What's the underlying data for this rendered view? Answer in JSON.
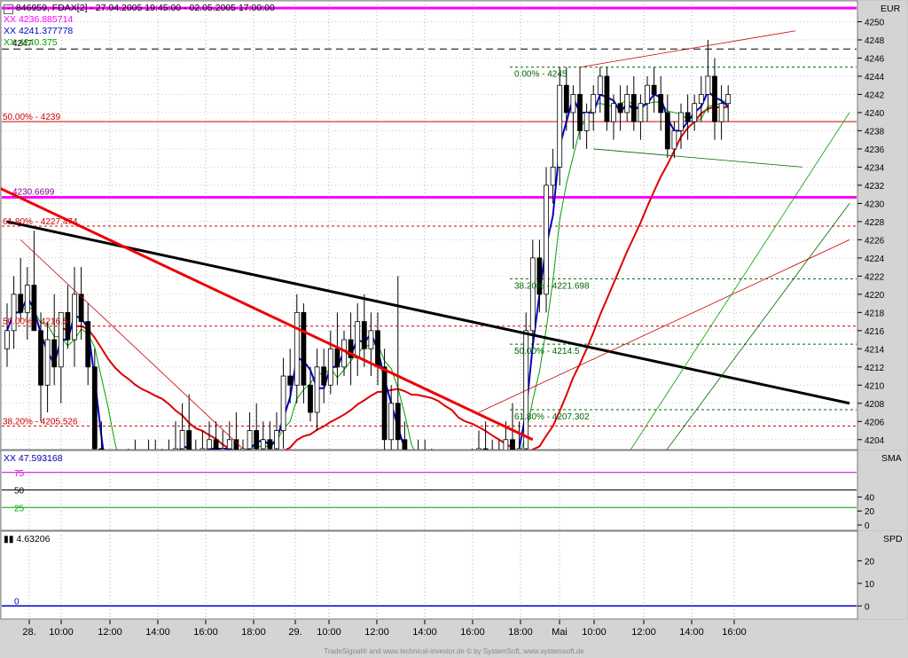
{
  "window": {
    "title": "846959, FDAX[2] - 27.04.2005 19:45:00 - 02.05.2005 17:00:00",
    "footer": "TradeSignal® and www.technical-investor.de © by SystemSoft, www.systemsoft.de"
  },
  "colors": {
    "candle": "#000000",
    "bb_blue": "#0000cc",
    "green": "#00a000",
    "ma_red": "#dd0000",
    "magenta": "#ff00ff",
    "fib_red": "#cc0000",
    "fib_green": "#006600",
    "trend_black": "#000000",
    "trend_red": "#ee0000",
    "bars": "#808080",
    "indicator_blue": "#0000aa"
  },
  "legend": [
    {
      "prefix": "XX",
      "value": "4236.885714",
      "color": "#ff00ff"
    },
    {
      "prefix": "XX",
      "value": "4241.377778",
      "color": "#0000cc"
    },
    {
      "prefix": "XX",
      "value": "4240.375",
      "color": "#00a000"
    }
  ],
  "panels": {
    "price": {
      "unit": "EUR",
      "ylim": [
        4203,
        4252
      ]
    },
    "sma": {
      "label": "SMA",
      "legend": "XX 47.593168",
      "ylim": [
        -5,
        100
      ]
    },
    "spd": {
      "label": "SPD",
      "legend": "4.63206",
      "ylim": [
        -5,
        28
      ]
    }
  },
  "time_axis": [
    "28.",
    "10:00",
    "12:00",
    "14:00",
    "16:00",
    "18:00",
    "29.",
    "10:00",
    "12:00",
    "14:00",
    "16:00",
    "18:00",
    "Mai",
    "10:00",
    "12:00",
    "14:00",
    "16:00"
  ],
  "chart_data": [
    {
      "type": "candlestick",
      "title": "846959, FDAX[2] - 27.04.2005 19:45:00 - 02.05.2005 17:00:00",
      "ylabel": "EUR",
      "y_ticks": [
        4204,
        4206,
        4208,
        4210,
        4212,
        4214,
        4216,
        4218,
        4220,
        4222,
        4224,
        4226,
        4228,
        4230,
        4232,
        4234,
        4236,
        4238,
        4240,
        4242,
        4244,
        4246,
        4248,
        4250
      ],
      "ylim": [
        4203,
        4252
      ],
      "horizontal_lines": [
        {
          "label": "4236.885714",
          "price": 4251.5,
          "style": "solid-magenta",
          "label_price": 4252.4
        },
        {
          "label": "4247",
          "price": 4247,
          "style": "dashed-black"
        },
        {
          "label": "4230.6699",
          "price": 4230.67,
          "style": "solid-magenta"
        }
      ],
      "fib_left": [
        {
          "label": "50.00% - 4239",
          "price": 4239
        },
        {
          "label": "61.80% - 4227.474",
          "price": 4227.5
        },
        {
          "label": "50.00% - 4216.5",
          "price": 4216.5,
          "level_label": "50.00% - 4216.5"
        },
        {
          "label": "38.20% - 4205.526",
          "price": 4205.5
        }
      ],
      "fib_right": [
        {
          "label": "0.00% - 4245",
          "price": 4245
        },
        {
          "label": "38.20% - 4221.698",
          "price": 4221.7
        },
        {
          "label": "50.00% - 4214.5",
          "price": 4214.5
        },
        {
          "label": "61.80% - 4207.302",
          "price": 4207.3
        }
      ],
      "candles": [
        [
          4214,
          4219,
          4212,
          4216
        ],
        [
          4216,
          4222,
          4214,
          4220
        ],
        [
          4220,
          4224,
          4217,
          4218
        ],
        [
          4218,
          4223,
          4215,
          4221
        ],
        [
          4221,
          4227,
          4219,
          4216
        ],
        [
          4216,
          4218,
          4206,
          4210
        ],
        [
          4210,
          4217,
          4207,
          4215
        ],
        [
          4215,
          4220,
          4210,
          4212
        ],
        [
          4212,
          4216,
          4208,
          4218
        ],
        [
          4218,
          4221,
          4214,
          4215
        ],
        [
          4215,
          4223,
          4212,
          4220
        ],
        [
          4220,
          4223,
          4215,
          4217
        ],
        [
          4217,
          4219,
          4210,
          4212
        ],
        [
          4212,
          4214,
          4200,
          4203
        ],
        [
          4203,
          4206,
          4196,
          4198
        ],
        [
          4198,
          4201,
          4192,
          4195
        ],
        [
          4195,
          4199,
          4191,
          4197
        ],
        [
          4197,
          4202,
          4194,
          4199
        ],
        [
          4199,
          4203,
          4196,
          4201
        ],
        [
          4201,
          4204,
          4197,
          4198
        ],
        [
          4198,
          4202,
          4195,
          4200
        ],
        [
          4200,
          4204,
          4197,
          4202
        ],
        [
          4202,
          4204,
          4199,
          4200
        ],
        [
          4200,
          4203,
          4198,
          4201
        ],
        [
          4201,
          4204,
          4199,
          4202
        ],
        [
          4202,
          4206,
          4200,
          4203
        ],
        [
          4203,
          4208,
          4201,
          4205
        ],
        [
          4205,
          4209,
          4200,
          4201
        ],
        [
          4201,
          4204,
          4198,
          4202
        ],
        [
          4202,
          4205,
          4200,
          4203
        ],
        [
          4203,
          4206,
          4201,
          4204
        ],
        [
          4204,
          4206,
          4201,
          4202
        ],
        [
          4202,
          4205,
          4199,
          4203
        ],
        [
          4203,
          4206,
          4201,
          4204
        ],
        [
          4204,
          4207,
          4200,
          4201
        ],
        [
          4201,
          4204,
          4199,
          4203
        ],
        [
          4203,
          4207,
          4201,
          4205
        ],
        [
          4205,
          4208,
          4202,
          4203
        ],
        [
          4203,
          4206,
          4200,
          4204
        ],
        [
          4204,
          4206,
          4202,
          4203
        ],
        [
          4203,
          4207,
          4200,
          4205
        ],
        [
          4205,
          4213,
          4203,
          4211
        ],
        [
          4211,
          4214,
          4208,
          4210
        ],
        [
          4210,
          4220,
          4208,
          4218
        ],
        [
          4218,
          4219,
          4208,
          4210
        ],
        [
          4210,
          4212,
          4206,
          4207
        ],
        [
          4207,
          4214,
          4205,
          4212
        ],
        [
          4212,
          4214,
          4208,
          4210
        ],
        [
          4210,
          4216,
          4209,
          4214
        ],
        [
          4214,
          4218,
          4210,
          4212
        ],
        [
          4212,
          4216,
          4211,
          4215
        ],
        [
          4215,
          4218,
          4210,
          4213
        ],
        [
          4213,
          4219,
          4211,
          4217
        ],
        [
          4217,
          4220,
          4212,
          4214
        ],
        [
          4214,
          4218,
          4211,
          4216
        ],
        [
          4216,
          4218,
          4210,
          4212
        ],
        [
          4212,
          4214,
          4202,
          4204
        ],
        [
          4204,
          4210,
          4200,
          4208
        ],
        [
          4208,
          4222,
          4200,
          4204
        ],
        [
          4204,
          4206,
          4195,
          4197
        ],
        [
          4197,
          4200,
          4193,
          4196
        ],
        [
          4196,
          4204,
          4195,
          4202
        ],
        [
          4202,
          4204,
          4197,
          4200
        ],
        [
          4200,
          4203,
          4197,
          4199
        ],
        [
          4199,
          4202,
          4195,
          4197
        ],
        [
          4197,
          4200,
          4195,
          4198
        ],
        [
          4198,
          4201,
          4196,
          4199
        ],
        [
          4199,
          4201,
          4196,
          4198
        ],
        [
          4198,
          4202,
          4196,
          4200
        ],
        [
          4200,
          4203,
          4198,
          4201
        ],
        [
          4201,
          4205,
          4199,
          4203
        ],
        [
          4203,
          4206,
          4199,
          4200
        ],
        [
          4200,
          4204,
          4197,
          4202
        ],
        [
          4202,
          4204,
          4199,
          4201
        ],
        [
          4201,
          4206,
          4199,
          4204
        ],
        [
          4204,
          4208,
          4200,
          4202
        ],
        [
          4202,
          4206,
          4200,
          4203
        ],
        [
          4203,
          4218,
          4202,
          4216
        ],
        [
          4216,
          4226,
          4214,
          4224
        ],
        [
          4224,
          4226,
          4218,
          4220
        ],
        [
          4220,
          4234,
          4218,
          4232
        ],
        [
          4232,
          4236,
          4230,
          4234
        ],
        [
          4234,
          4245,
          4232,
          4243
        ],
        [
          4243,
          4245,
          4238,
          4240
        ],
        [
          4240,
          4243,
          4236,
          4242
        ],
        [
          4242,
          4245,
          4237,
          4238
        ],
        [
          4238,
          4241,
          4236,
          4240
        ],
        [
          4240,
          4243,
          4238,
          4242
        ],
        [
          4242,
          4245,
          4240,
          4244
        ],
        [
          4244,
          4245,
          4238,
          4239
        ],
        [
          4239,
          4242,
          4237,
          4241
        ],
        [
          4241,
          4243,
          4238,
          4240
        ],
        [
          4240,
          4243,
          4239,
          4242
        ],
        [
          4242,
          4244,
          4238,
          4239
        ],
        [
          4239,
          4242,
          4237,
          4241
        ],
        [
          4241,
          4244,
          4239,
          4243
        ],
        [
          4243,
          4245,
          4240,
          4242
        ],
        [
          4242,
          4244,
          4238,
          4240
        ],
        [
          4240,
          4242,
          4235,
          4236
        ],
        [
          4236,
          4239,
          4235,
          4238
        ],
        [
          4238,
          4241,
          4236,
          4240
        ],
        [
          4240,
          4242,
          4237,
          4239
        ],
        [
          4239,
          4242,
          4238,
          4241
        ],
        [
          4241,
          4244,
          4239,
          4242
        ],
        [
          4242,
          4248,
          4240,
          4244
        ],
        [
          4244,
          4246,
          4237,
          4239
        ],
        [
          4239,
          4243,
          4237,
          4241
        ],
        [
          4241,
          4243,
          4239,
          4242
        ]
      ]
    },
    {
      "type": "line",
      "title": "SMA",
      "y_ticks": [
        0,
        20,
        40,
        75
      ],
      "levels": [
        {
          "label": "75",
          "value": 75,
          "color": "#cc00cc"
        },
        {
          "label": "50",
          "value": 50,
          "color": "#000000"
        },
        {
          "label": "25",
          "value": 25,
          "color": "#00a000"
        }
      ],
      "values": [
        62,
        55,
        48,
        50,
        52,
        46,
        40,
        45,
        48,
        50,
        44,
        30,
        20,
        15,
        22,
        35,
        48,
        55,
        58,
        60,
        55,
        50,
        45,
        42,
        50,
        58,
        60,
        55,
        50,
        45,
        40,
        30,
        26,
        25,
        28,
        35,
        45,
        55,
        50,
        40,
        45,
        55,
        65,
        72,
        70,
        60,
        55,
        58,
        66,
        72,
        70,
        62,
        55,
        50,
        40,
        30,
        22,
        15,
        25,
        35,
        45,
        40,
        35,
        38,
        48,
        52,
        35,
        18,
        30,
        50,
        68,
        72,
        74,
        66,
        58,
        54,
        56,
        62,
        66,
        60,
        48,
        40,
        52,
        62,
        68,
        55,
        38,
        22,
        30,
        50,
        62,
        66,
        70,
        60,
        50,
        45,
        40,
        35,
        48,
        58,
        62,
        55,
        50,
        48
      ]
    },
    {
      "type": "bar",
      "title": "SPD",
      "y_ticks": [
        0,
        10,
        20
      ],
      "values": [
        6,
        9,
        11,
        13,
        14,
        15,
        15,
        14,
        13,
        12,
        10,
        8,
        6,
        4,
        2,
        0,
        -2,
        -3,
        -4,
        -5,
        -5,
        -5,
        -5,
        -5,
        -5,
        -4,
        -4,
        -3,
        -3,
        -3,
        -3,
        -3,
        -3,
        -3,
        -3,
        -3,
        -3,
        -2,
        -1,
        0,
        2,
        4,
        6,
        8,
        10,
        12,
        13,
        14,
        15,
        15,
        15,
        14,
        14,
        13,
        12,
        10,
        8,
        6,
        4,
        2,
        0,
        -1,
        -2,
        -3,
        -4,
        -5,
        -5,
        -5,
        -5,
        -4,
        -3,
        -2,
        -1,
        0,
        2,
        4,
        6,
        8,
        12,
        15,
        18,
        21,
        23,
        25,
        26,
        27,
        27,
        26,
        25,
        24,
        23,
        22,
        21,
        20,
        19,
        18,
        17,
        16,
        15,
        14,
        13,
        12,
        10,
        9,
        8,
        7,
        6,
        5,
        4
      ]
    }
  ]
}
